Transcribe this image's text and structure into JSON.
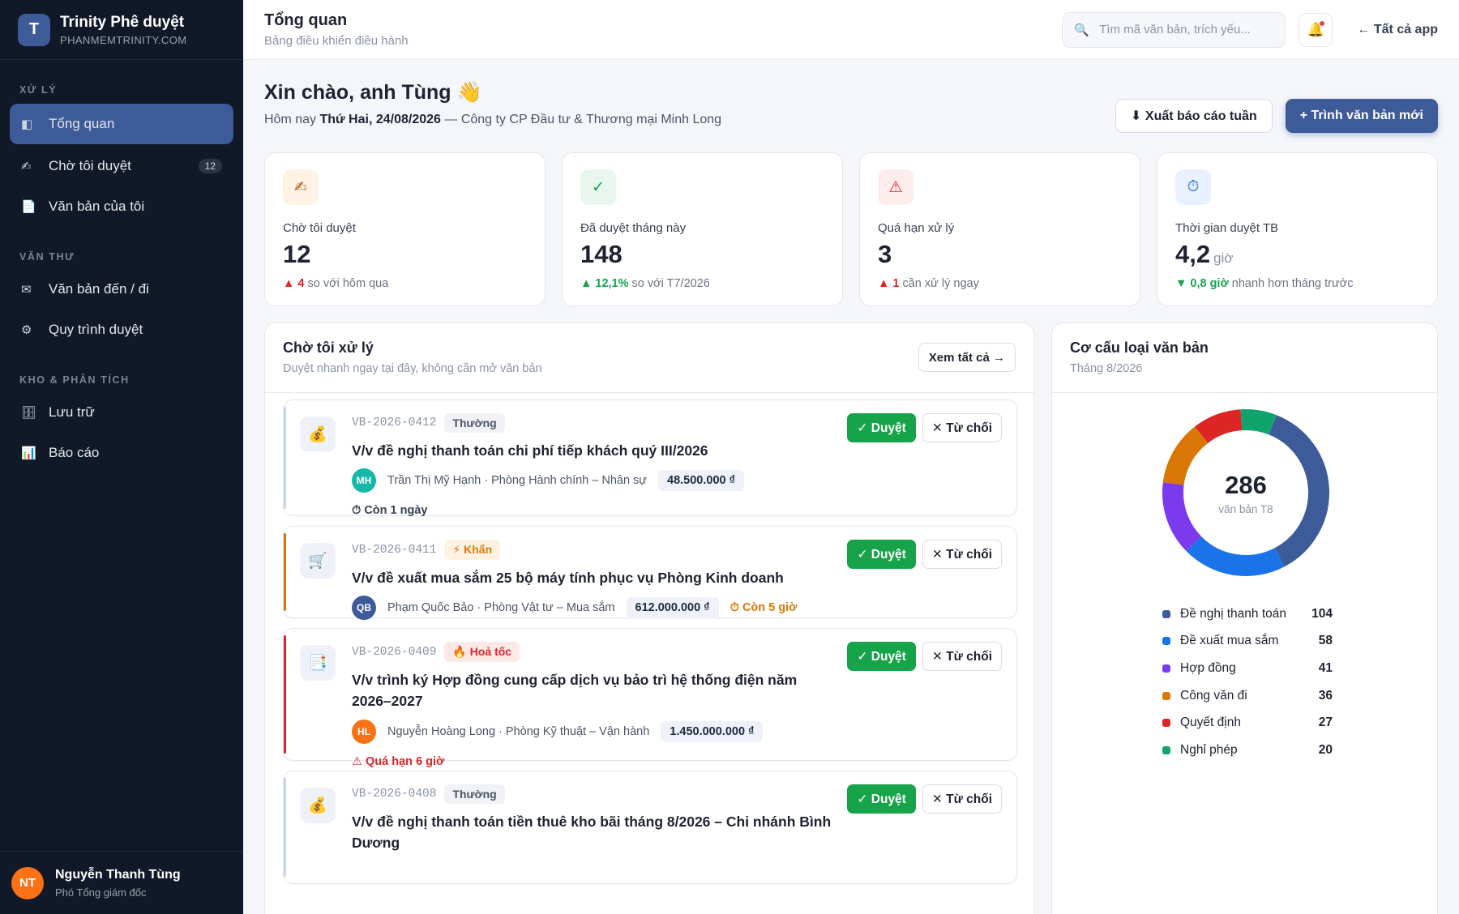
{
  "brand": {
    "logo_letter": "T",
    "title": "Trinity Phê duyệt",
    "subtitle": "PHANMEMTRINITY.COM"
  },
  "sidebar": {
    "sections": [
      {
        "title": "XỬ LÝ",
        "items": [
          {
            "label": "Tổng quan",
            "icon": "overview-icon",
            "glyph": "◧",
            "active": true
          },
          {
            "label": "Chờ tôi duyệt",
            "icon": "pen-icon",
            "glyph": "✍",
            "badge": "12"
          },
          {
            "label": "Văn bản của tôi",
            "icon": "document-icon",
            "glyph": "📄"
          }
        ]
      },
      {
        "title": "VĂN THƯ",
        "items": [
          {
            "label": "Văn bản đến / đi",
            "icon": "mail-icon",
            "glyph": "✉"
          },
          {
            "label": "Quy trình duyệt",
            "icon": "gear-icon",
            "glyph": "⚙"
          }
        ]
      },
      {
        "title": "KHO & PHÂN TÍCH",
        "items": [
          {
            "label": "Lưu trữ",
            "icon": "archive-icon",
            "glyph": "🗄"
          },
          {
            "label": "Báo cáo",
            "icon": "chart-icon",
            "glyph": "📊"
          }
        ]
      }
    ]
  },
  "user": {
    "initials": "NT",
    "name": "Nguyễn Thanh Tùng",
    "role": "Phó Tổng giám đốc"
  },
  "topbar": {
    "title": "Tổng quan",
    "subtitle": "Bảng điều khiển điều hành",
    "search_placeholder": "Tìm mã văn bản, trích yếu...",
    "back_label": "← Tất cả app"
  },
  "greeting": {
    "title": "Xin chào, anh Tùng 👋",
    "prefix": "Hôm nay ",
    "date": "Thứ Hai, 24/08/2026",
    "suffix": " — Công ty CP Đầu tư & Thương mại Minh Long"
  },
  "actions": {
    "export_label": "⬇ Xuất báo cáo tuần",
    "new_label": "+ Trình văn bản mới"
  },
  "kpis": [
    {
      "icon": "pen-icon",
      "glyph": "✍",
      "bg": "#fdf2e3",
      "fg": "#b45309",
      "label": "Chờ tôi duyệt",
      "value": "12",
      "unit": "",
      "trend_mark": "▲ 4",
      "trend_text": " so với hôm qua",
      "trend_kind": "up"
    },
    {
      "icon": "check-icon",
      "glyph": "✓",
      "bg": "#e8f6ee",
      "fg": "#16a34a",
      "label": "Đã duyệt tháng này",
      "value": "148",
      "unit": "",
      "trend_mark": "▲ 12,1%",
      "trend_text": " so với T7/2026",
      "trend_kind": "good"
    },
    {
      "icon": "warning-icon",
      "glyph": "⚠",
      "bg": "#fdecec",
      "fg": "#dc2626",
      "label": "Quá hạn xử lý",
      "value": "3",
      "unit": "",
      "trend_mark": "▲ 1",
      "trend_text": " cần xử lý ngay",
      "trend_kind": "up"
    },
    {
      "icon": "timer-icon",
      "glyph": "⏱",
      "bg": "#e8f1fd",
      "fg": "#2563eb",
      "label": "Thời gian duyệt TB",
      "value": "4,2",
      "unit": "giờ",
      "trend_mark": "▼ 0,8 giờ",
      "trend_text": " nhanh hơn tháng trước",
      "trend_kind": "good"
    }
  ],
  "queue": {
    "title": "Chờ tôi xử lý",
    "subtitle": "Duyệt nhanh ngay tại đây, không cần mở văn bản",
    "see_all": "Xem tất cả →",
    "approve_label": "✓ Duyệt",
    "reject_label": "✕ Từ chối",
    "items": [
      {
        "code": "VB-2026-0412",
        "priority": "Thường",
        "priority_kind": "normal",
        "icon": "money-bag-icon",
        "glyph": "💰",
        "accent": "#cbd5e1",
        "title": "V/v đề nghị thanh toán chi phí tiếp khách quý III/2026",
        "initials": "MH",
        "avatar_color": "#14b8a6",
        "person": "Trần Thị Mỹ Hạnh · Phòng Hành chính – Nhân sự",
        "amount": "48.500.000 ₫",
        "deadline": "⏱ Còn 1 ngày",
        "deadline_color": "#374151",
        "deadline_inline": false
      },
      {
        "code": "VB-2026-0411",
        "priority": "⚡ Khẩn",
        "priority_kind": "urgent",
        "icon": "cart-icon",
        "glyph": "🛒",
        "accent": "#d97706",
        "title": "V/v đề xuất mua sắm 25 bộ máy tính phục vụ Phòng Kinh doanh",
        "initials": "QB",
        "avatar_color": "#3d5a99",
        "person": "Phạm Quốc Bảo · Phòng Vật tư – Mua sắm",
        "amount": "612.000.000 ₫",
        "deadline": "⏱ Còn 5 giờ",
        "deadline_color": "#d97706",
        "deadline_inline": true
      },
      {
        "code": "VB-2026-0409",
        "priority": "🔥 Hoả tốc",
        "priority_kind": "fire",
        "icon": "contract-icon",
        "glyph": "📑",
        "accent": "#dc2626",
        "title": "V/v trình ký Hợp đồng cung cấp dịch vụ bảo trì hệ thống điện năm 2026–2027",
        "initials": "HL",
        "avatar_color": "#f97316",
        "person": "Nguyễn Hoàng Long · Phòng Kỹ thuật – Vận hành",
        "amount": "1.450.000.000 ₫",
        "deadline": "⚠ Quá hạn 6 giờ",
        "deadline_color": "#dc2626",
        "deadline_inline": false
      },
      {
        "code": "VB-2026-0408",
        "priority": "Thường",
        "priority_kind": "normal",
        "icon": "money-bag-icon",
        "glyph": "💰",
        "accent": "#cbd5e1",
        "title": "V/v đề nghị thanh toán tiền thuê kho bãi tháng 8/2026 – Chi nhánh Bình Dương",
        "initials": "",
        "avatar_color": "#6b7280",
        "person": "",
        "amount": "",
        "deadline": "",
        "deadline_color": "#374151",
        "deadline_inline": false
      }
    ]
  },
  "chart_panel": {
    "title": "Cơ cấu loại văn bản",
    "subtitle": "Tháng 8/2026"
  },
  "chart_data": {
    "type": "pie",
    "style": "donut",
    "center_value": "286",
    "center_label": "văn bản T8",
    "categories": [
      "Đề nghị thanh toán",
      "Đề xuất mua sắm",
      "Hợp đồng",
      "Công văn đi",
      "Quyết định",
      "Nghỉ phép"
    ],
    "values": [
      104,
      58,
      41,
      36,
      27,
      20
    ],
    "colors": [
      "#3d5a99",
      "#1a73e8",
      "#7c3aed",
      "#d97706",
      "#dc2626",
      "#10a36b"
    ],
    "legend": "bottom"
  }
}
